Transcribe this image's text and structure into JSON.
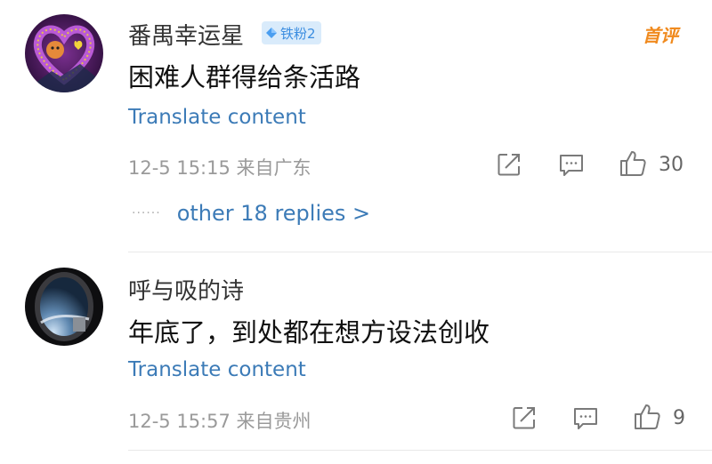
{
  "comments": [
    {
      "username": "番禺幸运星",
      "fan_badge": "铁粉2",
      "first_comment_tag": "首评",
      "text": "困难人群得给条活路",
      "translate": "Translate content",
      "meta": "12-5 15:15 来自广东",
      "like_count": "30",
      "more_replies": "other 18 replies >"
    },
    {
      "username": "呼与吸的诗",
      "text": "年底了，到处都在想方设法创收",
      "translate": "Translate content",
      "meta": "12-5 15:57 来自贵州",
      "like_count": "9"
    }
  ],
  "colors": {
    "link": "#3c7bb7",
    "meta": "#9a9a9a",
    "first_comment_tag": "#f08a1e",
    "fan_badge_bg": "#d9ebfb"
  }
}
